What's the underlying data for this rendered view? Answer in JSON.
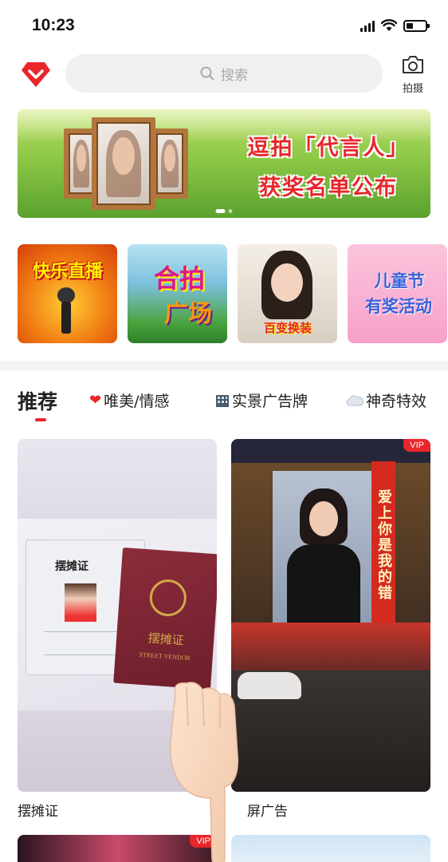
{
  "status_bar": {
    "time": "10:23",
    "signal_icon": "signal-icon",
    "wifi_icon": "wifi-icon",
    "battery_icon": "battery-icon"
  },
  "header": {
    "logo_icon": "diamond-logo-icon",
    "search": {
      "placeholder": "搜索",
      "icon": "search-icon"
    },
    "camera": {
      "label": "拍摄",
      "icon": "camera-icon"
    }
  },
  "banner": {
    "line1": "逗拍「代言人」",
    "line2": "获奖名单公布",
    "slide_count": 2,
    "active_slide": 1
  },
  "tiles": [
    {
      "label": "快乐直播"
    },
    {
      "label1": "合拍",
      "label2": "广场"
    },
    {
      "label": "百变换装"
    },
    {
      "label1": "儿童节",
      "label2": "有奖活动"
    }
  ],
  "tabs": [
    {
      "label": "推荐",
      "active": true
    },
    {
      "label": "唯美/情感",
      "icon": "heart-icon"
    },
    {
      "label": "实景广告牌",
      "icon": "building-icon"
    },
    {
      "label": "神奇特效",
      "icon": "cloud-icon"
    }
  ],
  "cards": [
    {
      "title": "摆摊证",
      "doc_title": "摆摊证",
      "doc_cover": "摆摊证",
      "doc_cover_en": "STREET VENDOR"
    },
    {
      "title": "屏广告",
      "vip": "VIP",
      "sign_text": "爱上你是我的错"
    }
  ],
  "bottom_cards": [
    {
      "vip": "VIP"
    }
  ],
  "colors": {
    "accent": "#e8262c",
    "search_bg": "#f0f0f0"
  }
}
